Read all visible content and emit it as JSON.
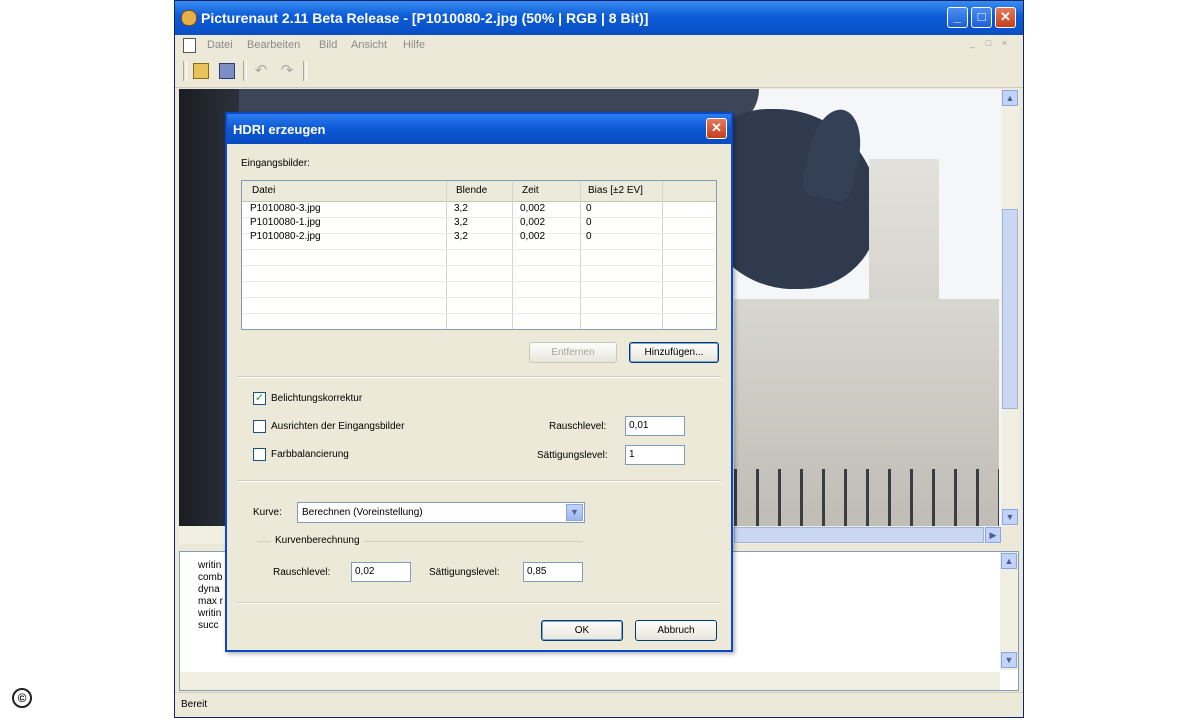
{
  "window": {
    "title": "Picturenaut 2.11 Beta Release - [P1010080-2.jpg (50% | RGB | 8 Bit)]",
    "controls": {
      "minimize": "_",
      "maximize": "□",
      "close": "✕"
    }
  },
  "menubar": {
    "items": [
      "Datei",
      "Bearbeiten",
      "Bild",
      "Ansicht",
      "Hilfe"
    ],
    "mdi_controls": [
      "_",
      "□",
      "×"
    ]
  },
  "toolbar": {
    "items": [
      "open-folder-icon",
      "save-icon",
      "undo-icon",
      "redo-icon"
    ]
  },
  "log": {
    "lines": [
      "writin",
      "comb",
      "dyna",
      "max r",
      "writin",
      "succ"
    ]
  },
  "statusbar": {
    "text": "Bereit"
  },
  "dialog": {
    "title": "HDRI erzeugen",
    "close": "✕",
    "input_images_label": "Eingangsbilder:",
    "columns": [
      "Datei",
      "Blende",
      "Zeit",
      "Bias [±2 EV]"
    ],
    "rows": [
      [
        "P1010080-3.jpg",
        "3,2",
        "0,002",
        "0"
      ],
      [
        "P1010080-1.jpg",
        "3,2",
        "0,002",
        "0"
      ],
      [
        "P1010080-2.jpg",
        "3,2",
        "0,002",
        "0"
      ]
    ],
    "remove_button": "Entfernen",
    "add_button": "Hinzufügen...",
    "exposure_correction": {
      "label": "Belichtungskorrektur",
      "checked": true
    },
    "align_images": {
      "label": "Ausrichten der Eingangsbilder",
      "checked": false
    },
    "color_balance": {
      "label": "Farbbalancierung",
      "checked": false
    },
    "noise_label": "Rauschlevel:",
    "noise_value": "0,01",
    "saturation_label": "Sättigungslevel:",
    "saturation_value": "1",
    "curve_label": "Kurve:",
    "curve_value": "Berechnen (Voreinstellung)",
    "curve_calc_group": "Kurvenberechnung",
    "curve_noise_label": "Rauschlevel:",
    "curve_noise_value": "0,02",
    "curve_saturation_label": "Sättigungslevel:",
    "curve_saturation_value": "0,85",
    "ok_button": "OK",
    "cancel_button": "Abbruch"
  },
  "watermark": "©"
}
